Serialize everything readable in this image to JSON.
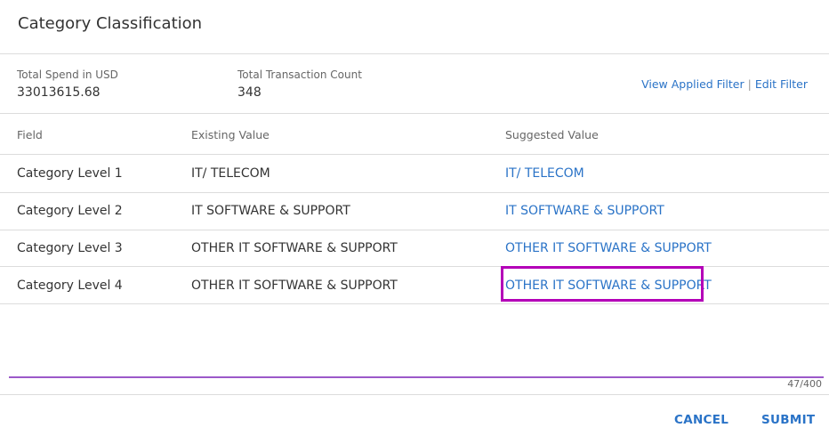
{
  "dialog": {
    "title": "Category Classification"
  },
  "summary": {
    "spend_label": "Total Spend in USD",
    "spend_value": "33013615.68",
    "count_label": "Total Transaction Count",
    "count_value": "348"
  },
  "filter": {
    "view_label": "View Applied Filter",
    "separator": "|",
    "edit_label": "Edit Filter"
  },
  "table": {
    "headers": {
      "field": "Field",
      "existing": "Existing Value",
      "suggested": "Suggested Value"
    },
    "rows": [
      {
        "field": "Category Level 1",
        "existing": "IT/ TELECOM",
        "suggested": "IT/ TELECOM"
      },
      {
        "field": "Category Level 2",
        "existing": "IT SOFTWARE & SUPPORT",
        "suggested": "IT SOFTWARE & SUPPORT"
      },
      {
        "field": "Category Level 3",
        "existing": "OTHER IT SOFTWARE & SUPPORT",
        "suggested": "OTHER IT SOFTWARE & SUPPORT"
      },
      {
        "field": "Category Level 4",
        "existing": "OTHER IT SOFTWARE & SUPPORT",
        "suggested": "OTHER IT SOFTWARE & SUPPORT"
      }
    ]
  },
  "comment": {
    "counter": "47/400",
    "value": ""
  },
  "actions": {
    "cancel_label": "CANCEL",
    "submit_label": "SUBMIT"
  },
  "colors": {
    "accent": "#2a73c7",
    "highlight": "#b400b8",
    "underline": "#9b59c9"
  }
}
